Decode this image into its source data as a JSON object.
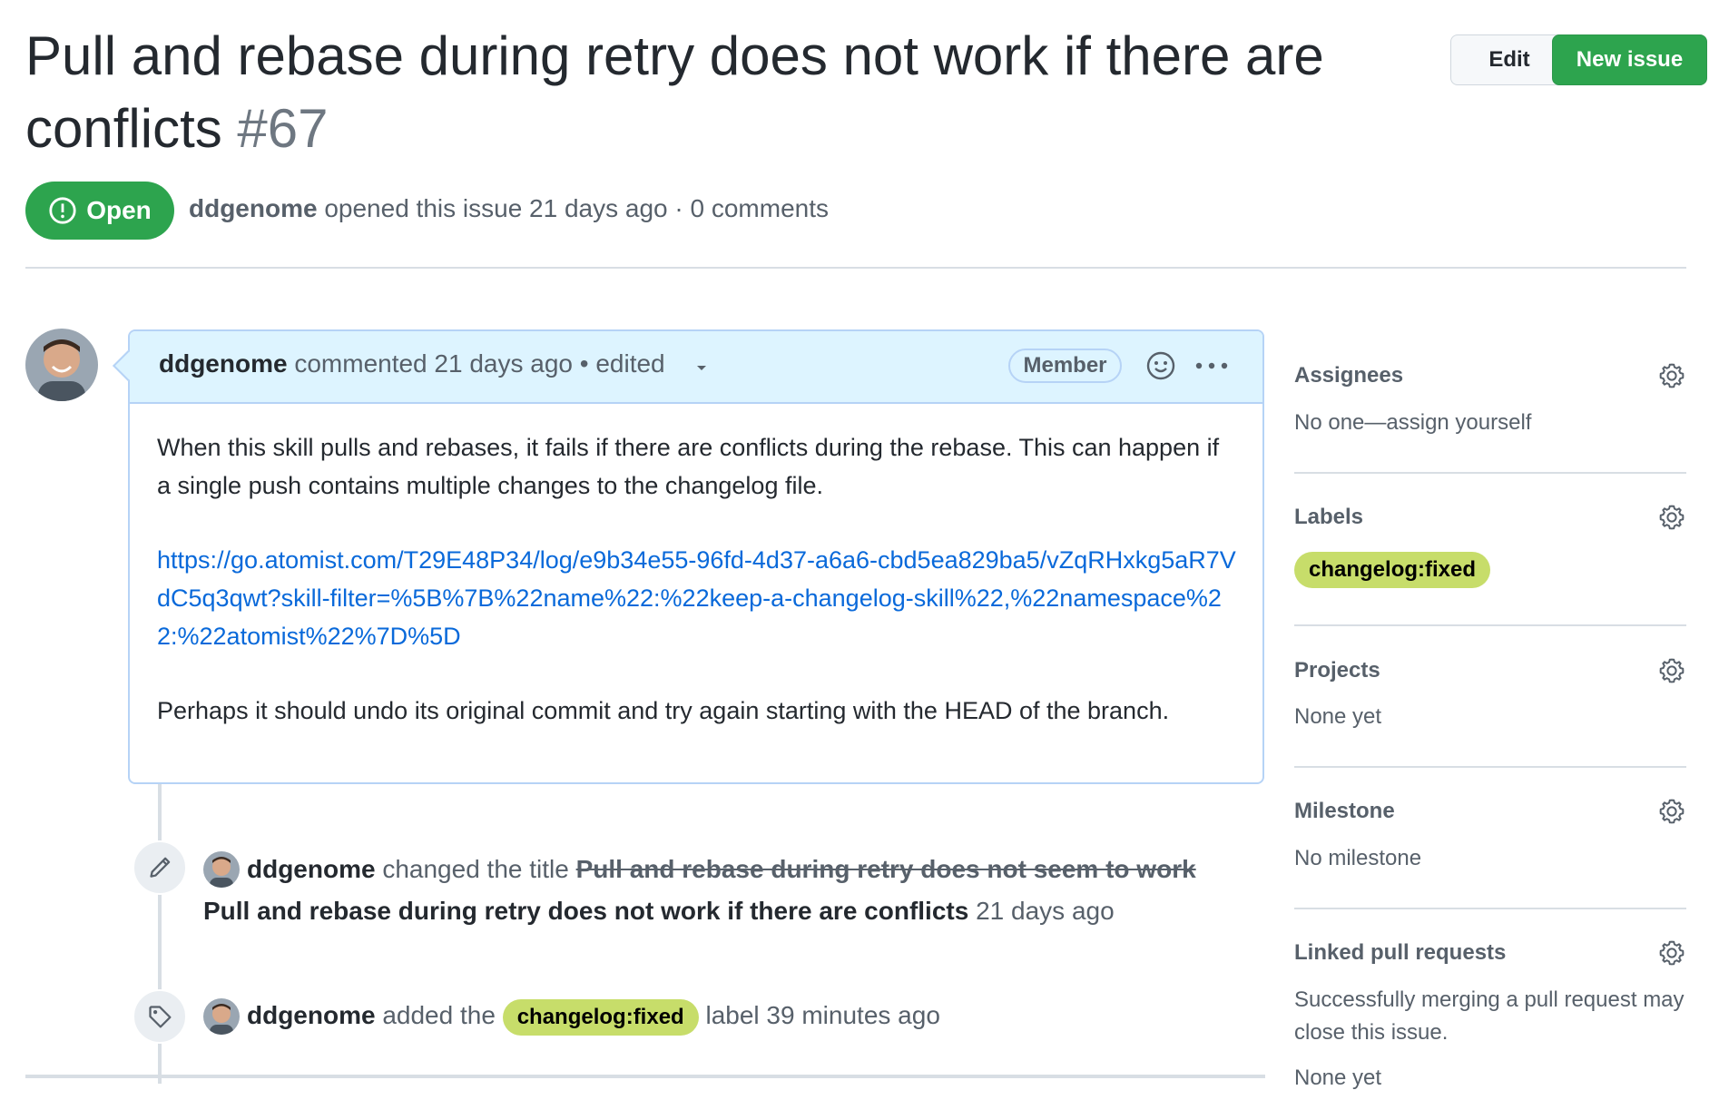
{
  "header": {
    "title": "Pull and rebase during retry does not work if there are conflicts",
    "number": "#67",
    "edit_label": "Edit",
    "new_issue_label": "New issue",
    "state": "Open",
    "author": "ddgenome",
    "opened_text": " opened this issue 21 days ago · 0 comments"
  },
  "comment": {
    "author": "ddgenome",
    "meta": " commented 21 days ago • edited",
    "role_badge": "Member",
    "paragraph1": "When this skill pulls and rebases, it fails if there are conflicts during the rebase. This can happen if a single push contains multiple changes to the changelog file.",
    "link": "https://go.atomist.com/T29E48P34/log/e9b34e55-96fd-4d37-a6a6-cbd5ea829ba5/vZqRHxkg5aR7VdC5q3qwt?skill-filter=%5B%7B%22name%22:%22keep-a-changelog-skill%22,%22namespace%22:%22atomist%22%7D%5D",
    "paragraph2": "Perhaps it should undo its original commit and try again starting with the HEAD of the branch."
  },
  "timeline": {
    "rename": {
      "actor": "ddgenome",
      "verb": " changed the title ",
      "old_title": "Pull and rebase during retry does not seem to work",
      "new_title": "Pull and rebase during retry does not work if there are conflicts",
      "time": " 21 days ago"
    },
    "label_event": {
      "actor": "ddgenome",
      "verb": " added the ",
      "label": "changelog:fixed",
      "suffix": " label 39 minutes ago"
    }
  },
  "sidebar": {
    "assignees": {
      "title": "Assignees",
      "value": "No one—assign yourself"
    },
    "labels": {
      "title": "Labels",
      "label": "changelog:fixed"
    },
    "projects": {
      "title": "Projects",
      "value": "None yet"
    },
    "milestone": {
      "title": "Milestone",
      "value": "No milestone"
    },
    "linked_prs": {
      "title": "Linked pull requests",
      "value": "Successfully merging a pull request may close this issue.",
      "value2": "None yet"
    }
  },
  "colors": {
    "open_green": "#2da44e",
    "label_bg": "#c7dd6a",
    "link_blue": "#0969da",
    "comment_header_bg": "#ddf4ff"
  }
}
